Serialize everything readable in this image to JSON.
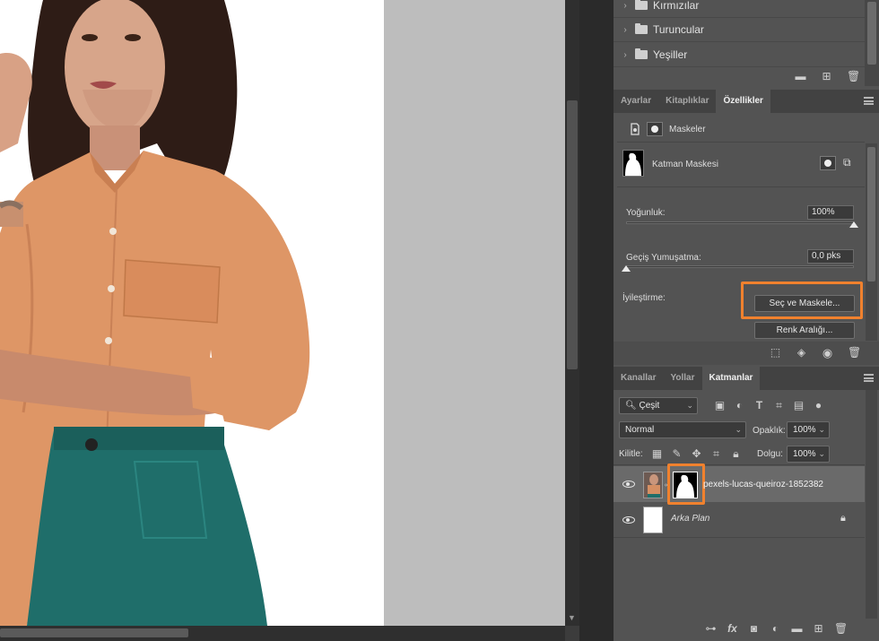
{
  "channels": {
    "items": [
      {
        "label": "Kırmızılar"
      },
      {
        "label": "Turuncular"
      },
      {
        "label": "Yeşiller"
      }
    ],
    "footer_icons": [
      "folder-icon",
      "new-icon",
      "trash-icon"
    ]
  },
  "properties_panel": {
    "tabs": [
      {
        "label": "Ayarlar",
        "active": false
      },
      {
        "label": "Kitaplıklar",
        "active": false
      },
      {
        "label": "Özellikler",
        "active": true
      }
    ],
    "header_label": "Maskeler",
    "mask_label": "Katman Maskesi",
    "density_label": "Yoğunluk:",
    "density_value": "100%",
    "density_level": 1.0,
    "feather_label": "Geçiş Yumuşatma:",
    "feather_value": "0,0 pks",
    "feather_level": 0.0,
    "refine_label": "İyileştirme:",
    "select_mask_button": "Seç ve Maskele...",
    "color_range_button": "Renk Aralığı..."
  },
  "layers_panel": {
    "tabs": [
      {
        "label": "Kanallar",
        "active": false
      },
      {
        "label": "Yollar",
        "active": false
      },
      {
        "label": "Katmanlar",
        "active": true
      }
    ],
    "filter_label": "Çeşit",
    "blend_mode": "Normal",
    "opacity_label": "Opaklık:",
    "opacity_value": "100%",
    "lock_label": "Kilitle:",
    "fill_label": "Dolgu:",
    "fill_value": "100%",
    "layers": [
      {
        "name": "pexels-lucas-queiroz-1852382",
        "visible": true,
        "selected": true
      },
      {
        "name": "Arka Plan",
        "visible": true,
        "selected": false,
        "locked": true
      }
    ],
    "footer_icons": [
      "link-icon",
      "fx-icon",
      "mask-icon",
      "adjustment-icon",
      "folder-icon",
      "new-layer-icon",
      "trash-icon"
    ]
  },
  "colors": {
    "accent_highlight": "#f0812e",
    "panel_bg": "#535353",
    "canvas_bg": "#bdbdbd"
  }
}
